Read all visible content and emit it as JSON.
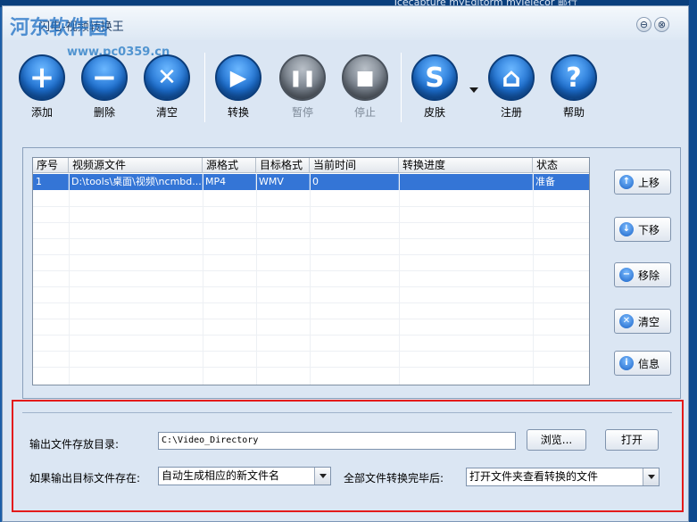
{
  "desktop": {
    "top_text": "Tcecapture    myEditorm    myJelecor        邮行"
  },
  "window": {
    "title": "闪电-视频转换王",
    "watermark": "河东软件园",
    "watermark_url": "www.pc0359.cn",
    "minimize_symbol": "⊖",
    "close_symbol": "⊗"
  },
  "toolbar": {
    "add": {
      "label": "添加",
      "symbol": "+"
    },
    "delete": {
      "label": "删除",
      "symbol": "−"
    },
    "clear": {
      "label": "清空",
      "symbol": "✕"
    },
    "convert": {
      "label": "转换",
      "symbol": "▶"
    },
    "pause": {
      "label": "暂停",
      "symbol": "❚❚"
    },
    "stop": {
      "label": "停止",
      "symbol": "■"
    },
    "skin": {
      "label": "皮肤",
      "symbol": "S"
    },
    "register": {
      "label": "注册",
      "symbol": "⌂"
    },
    "help": {
      "label": "帮助",
      "symbol": "?"
    }
  },
  "file_list": {
    "columns": [
      "序号",
      "视频源文件",
      "源格式",
      "目标格式",
      "当前时间",
      "转换进度",
      "状态"
    ],
    "rows": [
      {
        "index": "1",
        "source": "D:\\tools\\桌面\\视频\\ncmbd...",
        "src_format": "MP4",
        "dst_format": "WMV",
        "current_time": "0",
        "progress": "",
        "status": "准备"
      }
    ]
  },
  "side_buttons": {
    "move_up": {
      "label": "上移",
      "symbol": "↑"
    },
    "move_down": {
      "label": "下移",
      "symbol": "↓"
    },
    "remove": {
      "label": "移除",
      "symbol": "−"
    },
    "clear": {
      "label": "清空",
      "symbol": "✕"
    },
    "info": {
      "label": "信息",
      "symbol": "i"
    }
  },
  "settings": {
    "output_dir_label": "输出文件存放目录:",
    "output_dir_value": "C:\\Video_Directory",
    "browse_label": "浏览...",
    "open_label": "打开",
    "exists_label": "如果输出目标文件存在:",
    "exists_value": "自动生成相应的新文件名",
    "after_label": "全部文件转换完毕后:",
    "after_value": "打开文件夹查看转换的文件"
  }
}
